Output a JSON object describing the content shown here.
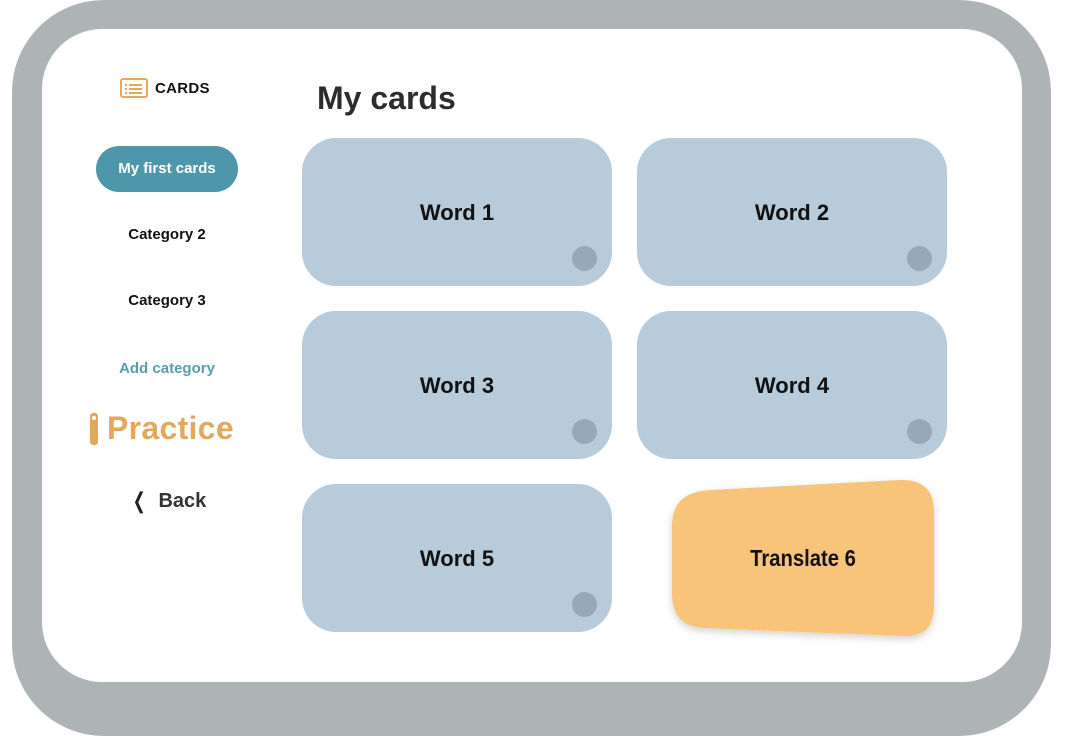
{
  "sidebar": {
    "logo_text": "CARDS",
    "logo_icon": "list-card-icon",
    "items": [
      {
        "label": "My first cards",
        "active": true
      },
      {
        "label": "Category 2",
        "active": false
      },
      {
        "label": "Category 3",
        "active": false
      }
    ],
    "add_category_label": "Add category",
    "practice_label": "Practice",
    "back_label": "Back",
    "back_icon": "chevron-left-icon"
  },
  "main": {
    "title": "My cards",
    "cards": [
      {
        "label": "Word 1"
      },
      {
        "label": "Word 2"
      },
      {
        "label": "Word 3"
      },
      {
        "label": "Word 4"
      },
      {
        "label": "Word 5"
      },
      {
        "label": "Translate 6",
        "flipped": true
      }
    ]
  },
  "colors": {
    "frame": "#aeb4b5",
    "accent": "#4e97ab",
    "practice": "#e2a95c",
    "card": "#b7cbdb",
    "card_flipped": "#f7c479",
    "card_dot": "#97a9b8"
  }
}
